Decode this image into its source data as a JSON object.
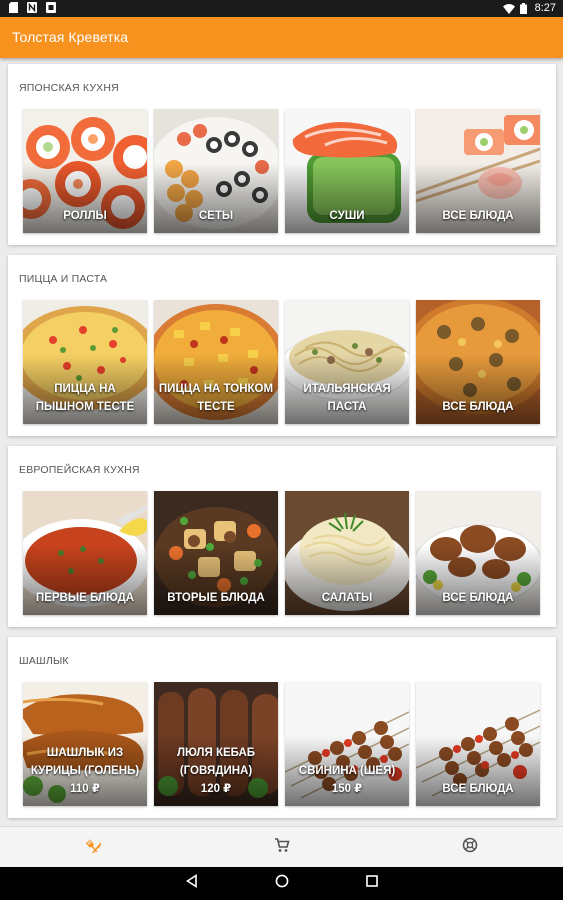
{
  "status_bar": {
    "icons": [
      "sd-card-icon",
      "n-notification-icon",
      "image-notification-icon"
    ],
    "time": "8:27"
  },
  "app_bar": {
    "title": "Толстая Креветка"
  },
  "sections": [
    {
      "title": "Японская кухня",
      "tiles": [
        {
          "label": "Роллы",
          "price": ""
        },
        {
          "label": "Сеты",
          "price": ""
        },
        {
          "label": "Суши",
          "price": ""
        },
        {
          "label": "Все блюда",
          "price": ""
        }
      ]
    },
    {
      "title": "Пицца и паста",
      "tiles": [
        {
          "label": "Пицца на пышном тесте",
          "price": ""
        },
        {
          "label": "Пицца на тонком тесте",
          "price": ""
        },
        {
          "label": "Итальянская паста",
          "price": ""
        },
        {
          "label": "Все блюда",
          "price": ""
        }
      ]
    },
    {
      "title": "Европейская кухня",
      "tiles": [
        {
          "label": "Первые блюда",
          "price": ""
        },
        {
          "label": "Вторые блюда",
          "price": ""
        },
        {
          "label": "Салаты",
          "price": ""
        },
        {
          "label": "Все блюда",
          "price": ""
        }
      ]
    },
    {
      "title": "Шашлык",
      "tiles": [
        {
          "label": "Шашлык из курицы (голень)",
          "price": "110 ₽"
        },
        {
          "label": "Люля кебаб (говядина)",
          "price": "120 ₽"
        },
        {
          "label": "Свинина (шея)",
          "price": "150 ₽"
        },
        {
          "label": "Все блюда",
          "price": ""
        }
      ]
    }
  ],
  "bottom_nav": {
    "items": [
      {
        "icon": "fork-knife-icon",
        "active": true
      },
      {
        "icon": "cart-icon",
        "active": false
      },
      {
        "icon": "info-icon",
        "active": false
      }
    ]
  },
  "theme": {
    "accent": "#f7921e",
    "active_nav": "#f7921e",
    "inactive_nav": "#555555"
  }
}
